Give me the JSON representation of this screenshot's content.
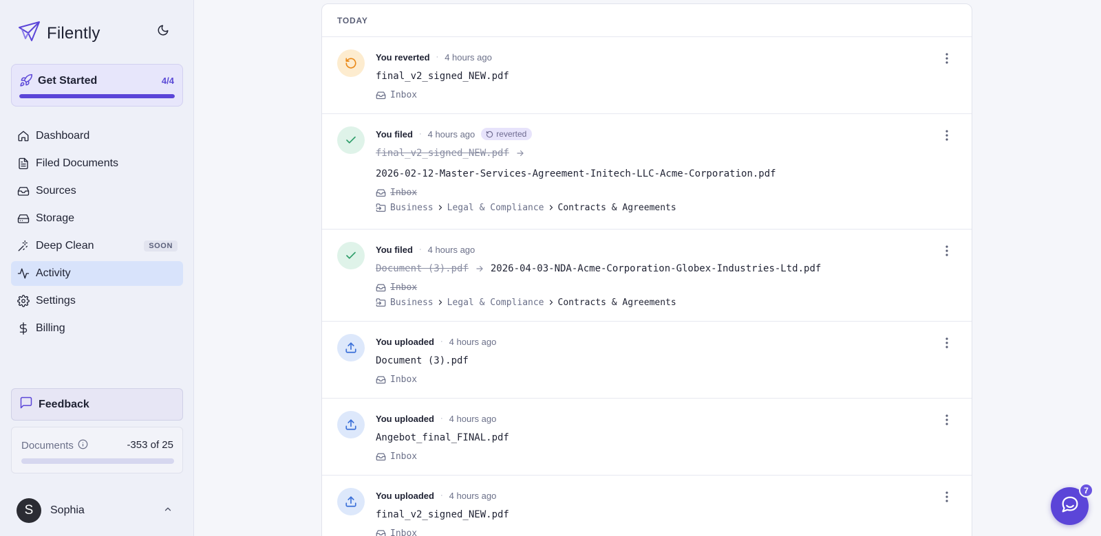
{
  "app": {
    "name": "Filently"
  },
  "get_started": {
    "title": "Get Started",
    "count": "4/4",
    "progress": 1.0
  },
  "nav": [
    {
      "label": "Dashboard",
      "icon": "home-icon"
    },
    {
      "label": "Filed Documents",
      "icon": "document-icon"
    },
    {
      "label": "Sources",
      "icon": "inbox-icon"
    },
    {
      "label": "Storage",
      "icon": "hard-drive-icon"
    },
    {
      "label": "Deep Clean",
      "icon": "magic-wand-icon",
      "badge": "SOON"
    },
    {
      "label": "Activity",
      "icon": "activity-icon",
      "active": true
    },
    {
      "label": "Settings",
      "icon": "gear-icon"
    },
    {
      "label": "Billing",
      "icon": "dollar-icon"
    }
  ],
  "feedback": {
    "label": "Feedback"
  },
  "documents": {
    "label": "Documents",
    "count": "-353 of 25"
  },
  "user": {
    "initial": "S",
    "name": "Sophia"
  },
  "feed": {
    "section": "TODAY",
    "sep": "·",
    "entries": [
      {
        "who": "You reverted",
        "time": "4 hours ago",
        "file": "final_v2_signed_NEW.pdf",
        "location": "Inbox"
      },
      {
        "who": "You filed",
        "time": "4 hours ago",
        "badge": "reverted",
        "from": "final_v2_signed_NEW.pdf",
        "to": "2026-02-12-Master-Services-Agreement-Initech-LLC-Acme-Corporation.pdf",
        "location": "Inbox",
        "path": [
          "Business",
          "Legal & Compliance",
          "Contracts & Agreements"
        ]
      },
      {
        "who": "You filed",
        "time": "4 hours ago",
        "from": "Document (3).pdf",
        "to": "2026-04-03-NDA-Acme-Corporation-Globex-Industries-Ltd.pdf",
        "location": "Inbox",
        "path": [
          "Business",
          "Legal & Compliance",
          "Contracts & Agreements"
        ]
      },
      {
        "who": "You uploaded",
        "time": "4 hours ago",
        "file": "Document (3).pdf",
        "location": "Inbox"
      },
      {
        "who": "You uploaded",
        "time": "4 hours ago",
        "file": "Angebot_final_FINAL.pdf",
        "location": "Inbox"
      },
      {
        "who": "You uploaded",
        "time": "4 hours ago",
        "file": "final_v2_signed_NEW.pdf",
        "location": "Inbox"
      }
    ]
  },
  "chat": {
    "unread": "7"
  },
  "colors": {
    "accent": "#5b45d8",
    "active_nav": "#d8e3fb",
    "revert": "#ea8a1a",
    "filed": "#2f9e6a",
    "upload": "#3a6fd8"
  }
}
